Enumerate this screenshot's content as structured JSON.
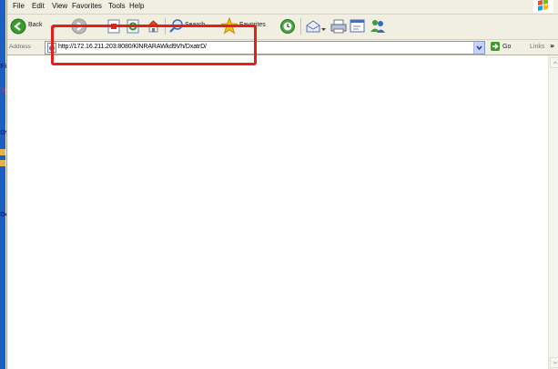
{
  "menu": [
    "File",
    "Edit",
    "View",
    "Favorites",
    "Tools",
    "Help"
  ],
  "toolbar": {
    "back_label": "Back",
    "search_label": "Search",
    "favorites_label": "Favorites"
  },
  "address": {
    "label": "Address",
    "url": "http://172.16.211.203:8080/KlNRARAWkd9Vh/DxatrD/"
  },
  "go_label": "Go",
  "links_label": "Links",
  "left_fragments": [
    "Fi",
    "Ot",
    "De"
  ],
  "colors": {
    "highlight": "#e3211b",
    "chrome": "#f1efe2",
    "xp_blue": "#1b5fc2"
  }
}
